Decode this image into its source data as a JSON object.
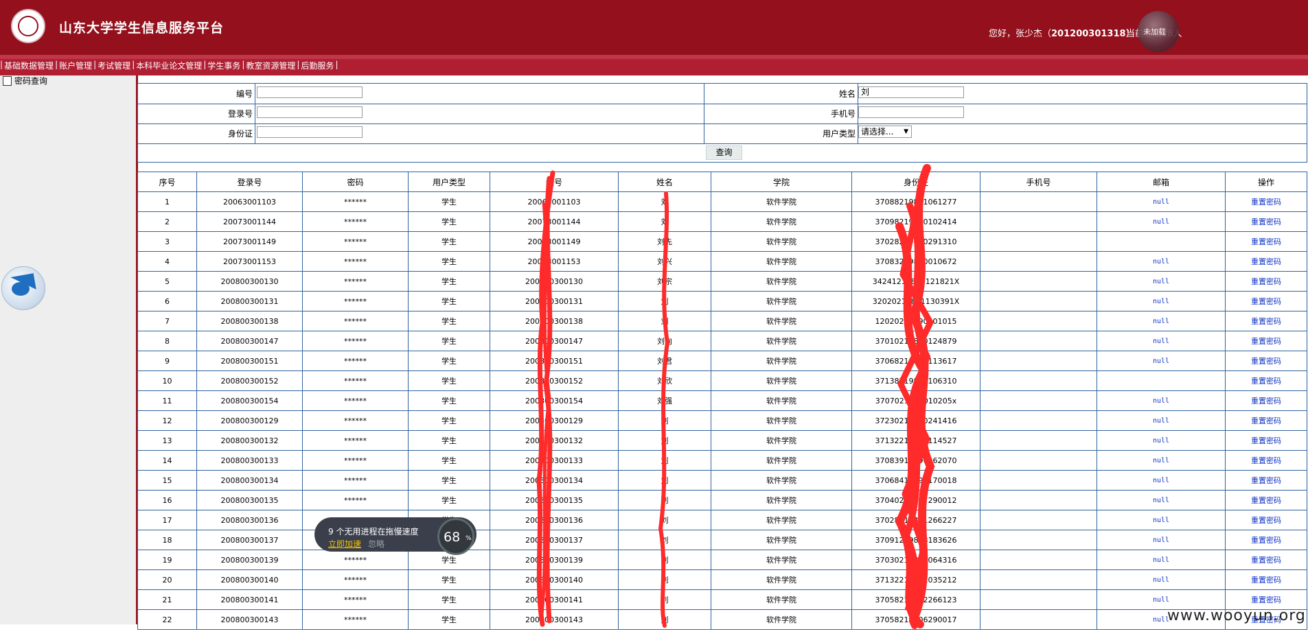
{
  "header": {
    "title": "山东大学学生信息服务平台",
    "welcome_prefix": "您好，张少杰（",
    "user_id": "201200301318",
    "welcome_suffix": "）",
    "online_text": "当前在线28人",
    "orb_label": "未加载"
  },
  "menu": [
    "基础数据管理",
    "账户管理",
    "考试管理",
    "本科毕业论文管理",
    "学生事务",
    "教室资源管理",
    "后勤服务"
  ],
  "sidebar": {
    "item": "密码查询"
  },
  "search": {
    "labels": {
      "id": "编号",
      "name": "姓名",
      "login": "登录号",
      "phone": "手机号",
      "idcard": "身份证",
      "usertype": "用户类型"
    },
    "values": {
      "id": "",
      "name": "刘",
      "login": "",
      "phone": "",
      "idcard": ""
    },
    "usertype_selected": "请选择...",
    "query_button": "查询"
  },
  "table": {
    "headers": [
      "序号",
      "登录号",
      "密码",
      "用户类型",
      "编号",
      "姓名",
      "学院",
      "身份证",
      "手机号",
      "邮箱",
      "操作"
    ],
    "rows": [
      [
        "1",
        "20063001103",
        "******",
        "学生",
        "20063001103",
        "刘",
        "软件学院",
        "37088219881061277",
        "",
        "null",
        "重置密码"
      ],
      [
        "2",
        "20073001144",
        "******",
        "学生",
        "20073001144",
        "刘",
        "软件学院",
        "37098219880102414",
        "",
        "null",
        "重置密码"
      ],
      [
        "3",
        "20073001149",
        "******",
        "学生",
        "20073001149",
        "刘先",
        "软件学院",
        "37028219890291310",
        "",
        "",
        "重置密码"
      ],
      [
        "4",
        "20073001153",
        "******",
        "学生",
        "20073001153",
        "刘兴",
        "软件学院",
        "37083219890010672",
        "",
        "null",
        "重置密码"
      ],
      [
        "5",
        "200800300130",
        "******",
        "学生",
        "200800300130",
        "刘宗",
        "软件学院",
        "34241219891121821X",
        "",
        "null",
        "重置密码"
      ],
      [
        "6",
        "200800300131",
        "******",
        "学生",
        "200800300131",
        "刘",
        "软件学院",
        "32020219891130391X",
        "",
        "null",
        "重置密码"
      ],
      [
        "7",
        "200800300138",
        "******",
        "学生",
        "200800300138",
        "刘",
        "软件学院",
        "12020219890101015",
        "",
        "null",
        "重置密码"
      ],
      [
        "8",
        "200800300147",
        "******",
        "学生",
        "200800300147",
        "刘向",
        "软件学院",
        "37010219890124879",
        "",
        "null",
        "重置密码"
      ],
      [
        "9",
        "200800300151",
        "******",
        "学生",
        "200800300151",
        "刘君",
        "软件学院",
        "37068219890113617",
        "",
        "null",
        "重置密码"
      ],
      [
        "10",
        "200800300152",
        "******",
        "学生",
        "200800300152",
        "刘欣",
        "软件学院",
        "37138219890106310",
        "",
        "",
        "重置密码"
      ],
      [
        "11",
        "200800300154",
        "******",
        "学生",
        "200800300154",
        "刘强",
        "软件学院",
        "3707021989010205x",
        "",
        "null",
        "重置密码"
      ],
      [
        "12",
        "200800300129",
        "******",
        "学生",
        "200800300129",
        "刘",
        "软件学院",
        "37230219890241416",
        "",
        "null",
        "重置密码"
      ],
      [
        "13",
        "200800300132",
        "******",
        "学生",
        "200800300132",
        "刘",
        "软件学院",
        "37132219891114527",
        "",
        "null",
        "重置密码"
      ],
      [
        "14",
        "200800300133",
        "******",
        "学生",
        "200800300133",
        "刘",
        "软件学院",
        "37083919890262070",
        "",
        "null",
        "重置密码"
      ],
      [
        "15",
        "200800300134",
        "******",
        "学生",
        "200800300134",
        "刘",
        "软件学院",
        "37068419890170018",
        "",
        "null",
        "重置密码"
      ],
      [
        "16",
        "200800300135",
        "******",
        "学生",
        "200800300135",
        "刘",
        "软件学院",
        "37040219897290012",
        "",
        "null",
        "重置密码"
      ],
      [
        "17",
        "200800300136",
        "******",
        "学生",
        "200800300136",
        "刘",
        "软件学院",
        "37028519891266227",
        "",
        "null",
        "重置密码"
      ],
      [
        "18",
        "200800300137",
        "******",
        "学生",
        "200800300137",
        "刘",
        "软件学院",
        "37091219898183626",
        "",
        "null",
        "重置密码"
      ],
      [
        "19",
        "200800300139",
        "******",
        "学生",
        "200800300139",
        "刘",
        "软件学院",
        "37030219890064316",
        "",
        "null",
        "重置密码"
      ],
      [
        "20",
        "200800300140",
        "******",
        "学生",
        "200800300140",
        "刘",
        "软件学院",
        "37132219902035212",
        "",
        "null",
        "重置密码"
      ],
      [
        "21",
        "200800300141",
        "******",
        "学生",
        "200800300141",
        "刘",
        "软件学院",
        "37058219902266123",
        "",
        "null",
        "重置密码"
      ],
      [
        "22",
        "200800300143",
        "******",
        "学生",
        "200800300143",
        "刘",
        "软件学院",
        "37058219906290017",
        "",
        "null",
        "重置密码"
      ]
    ]
  },
  "toast": {
    "message": "9 个无用进程在拖慢速度",
    "action": "立即加速",
    "ignore": "忽略",
    "percent": "68",
    "percent_sign": "%"
  },
  "watermark": "www.wooyun.org",
  "colors": {
    "header_bg": "#93101c",
    "menu_bg": "#b01e32",
    "table_border": "#30639e",
    "link": "#1236c6",
    "scribble": "#ff2a2a"
  }
}
